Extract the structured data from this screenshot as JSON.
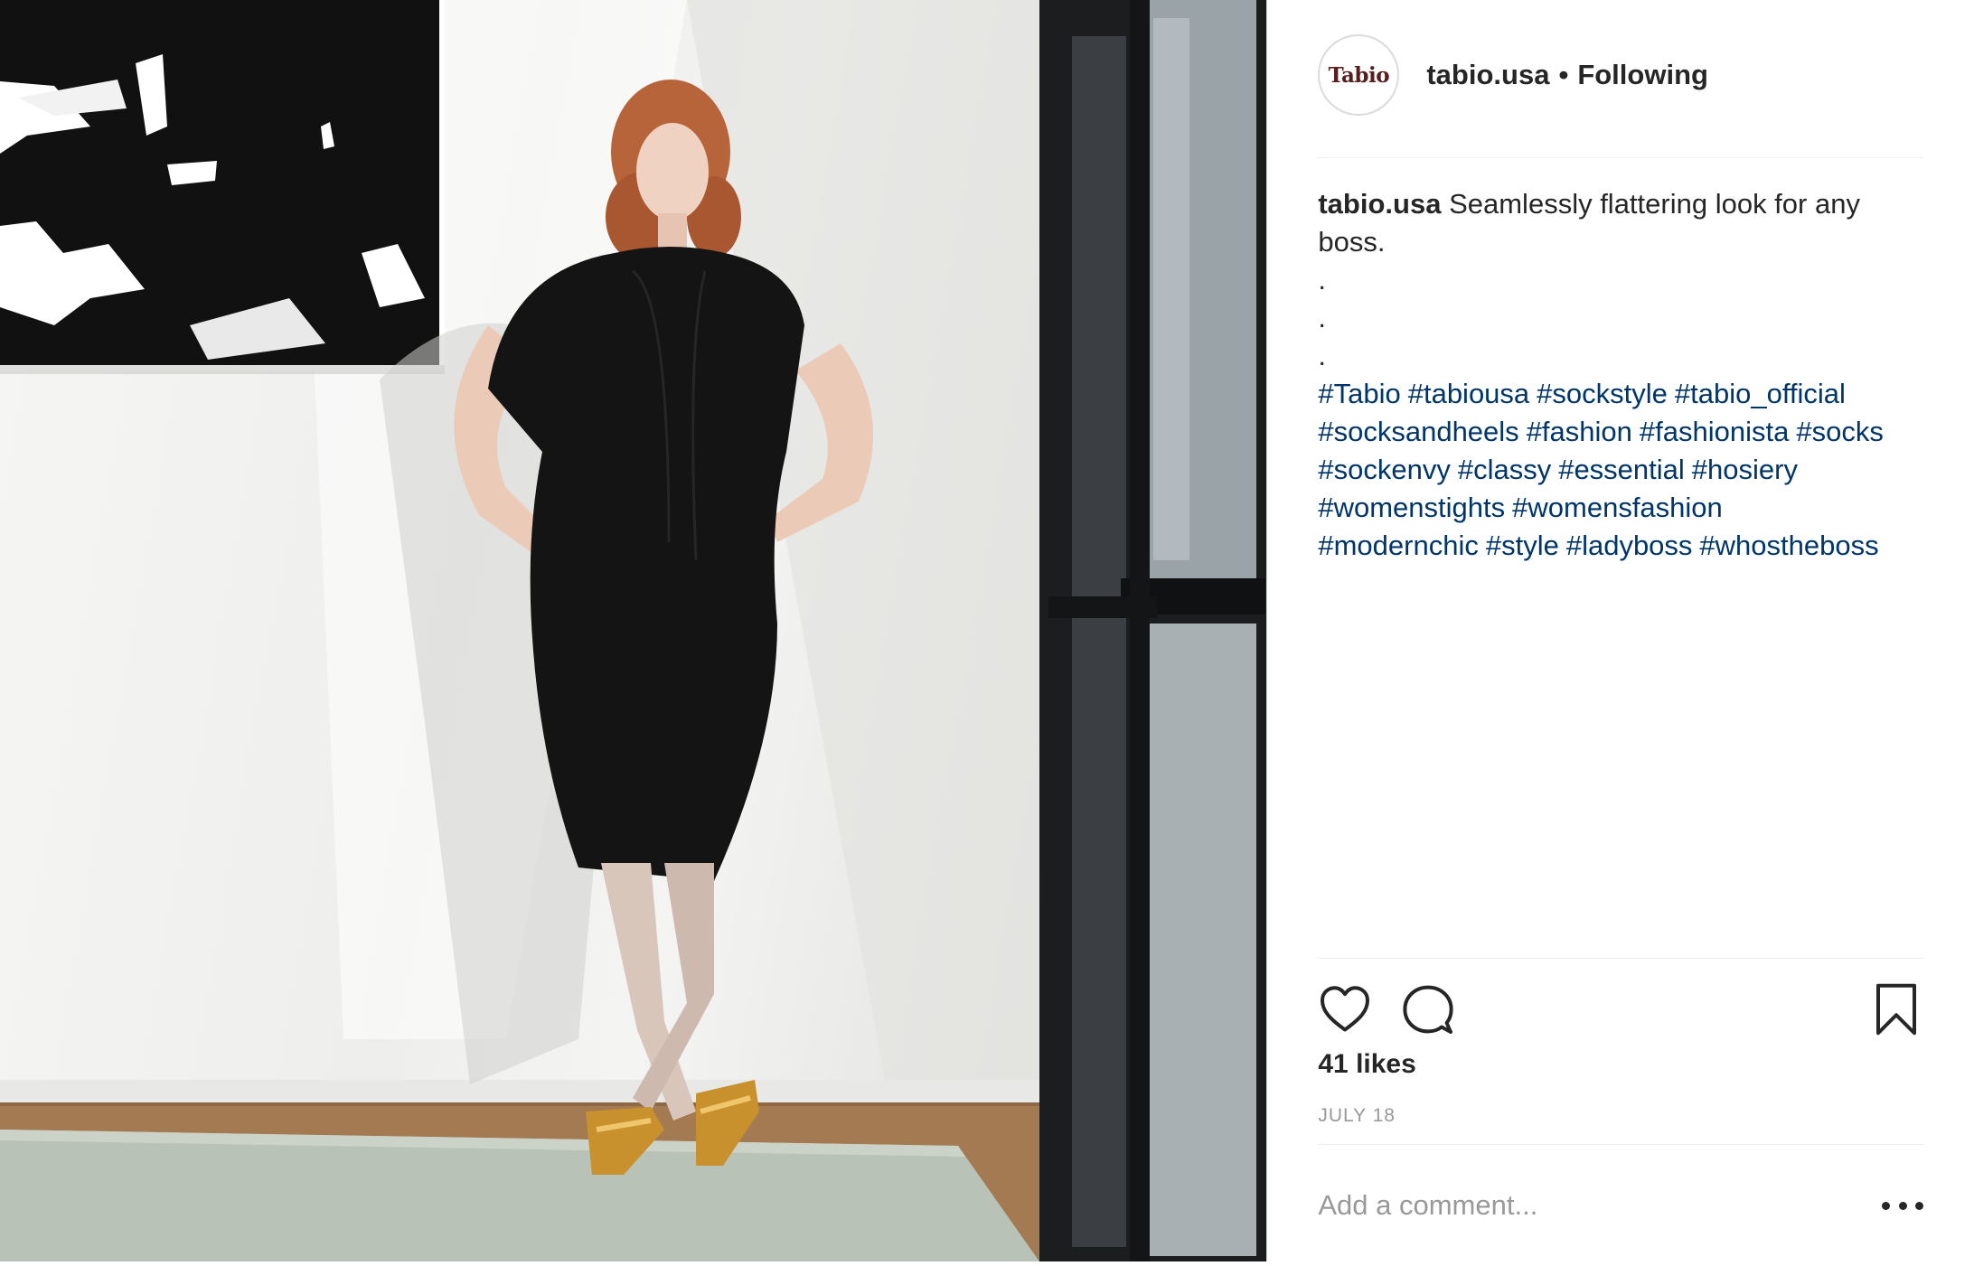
{
  "post": {
    "image_alt": "Model in black dress leaning against white wall with hands on hips",
    "account": {
      "avatar_text": "Tabio",
      "username": "tabio.usa",
      "separator": "•",
      "follow_status": "Following"
    },
    "caption": {
      "username": "tabio.usa",
      "text": "Seamlessly flattering look for any boss.",
      "spacer_lines": [
        ".",
        ".",
        "."
      ],
      "hashtags": [
        "#Tabio",
        "#tabiousa",
        "#sockstyle",
        "#tabio_official",
        "#socksandheels",
        "#fashion",
        "#fashionista",
        "#socks",
        "#sockenvy",
        "#classy",
        "#essential",
        "#hosiery",
        "#womenstights",
        "#womensfashion",
        "#modernchic",
        "#style",
        "#ladyboss",
        "#whostheboss"
      ]
    },
    "actions": {
      "like_icon": "heart-outline-icon",
      "comment_icon": "speech-bubble-icon",
      "save_icon": "bookmark-outline-icon"
    },
    "likes_text": "41 likes",
    "date": "JULY 18",
    "comment_placeholder": "Add a comment...",
    "more_icon": "ellipsis-icon"
  },
  "colors": {
    "text": "#262626",
    "hashtag": "#003569",
    "muted": "#999999",
    "divider": "#efefef"
  }
}
